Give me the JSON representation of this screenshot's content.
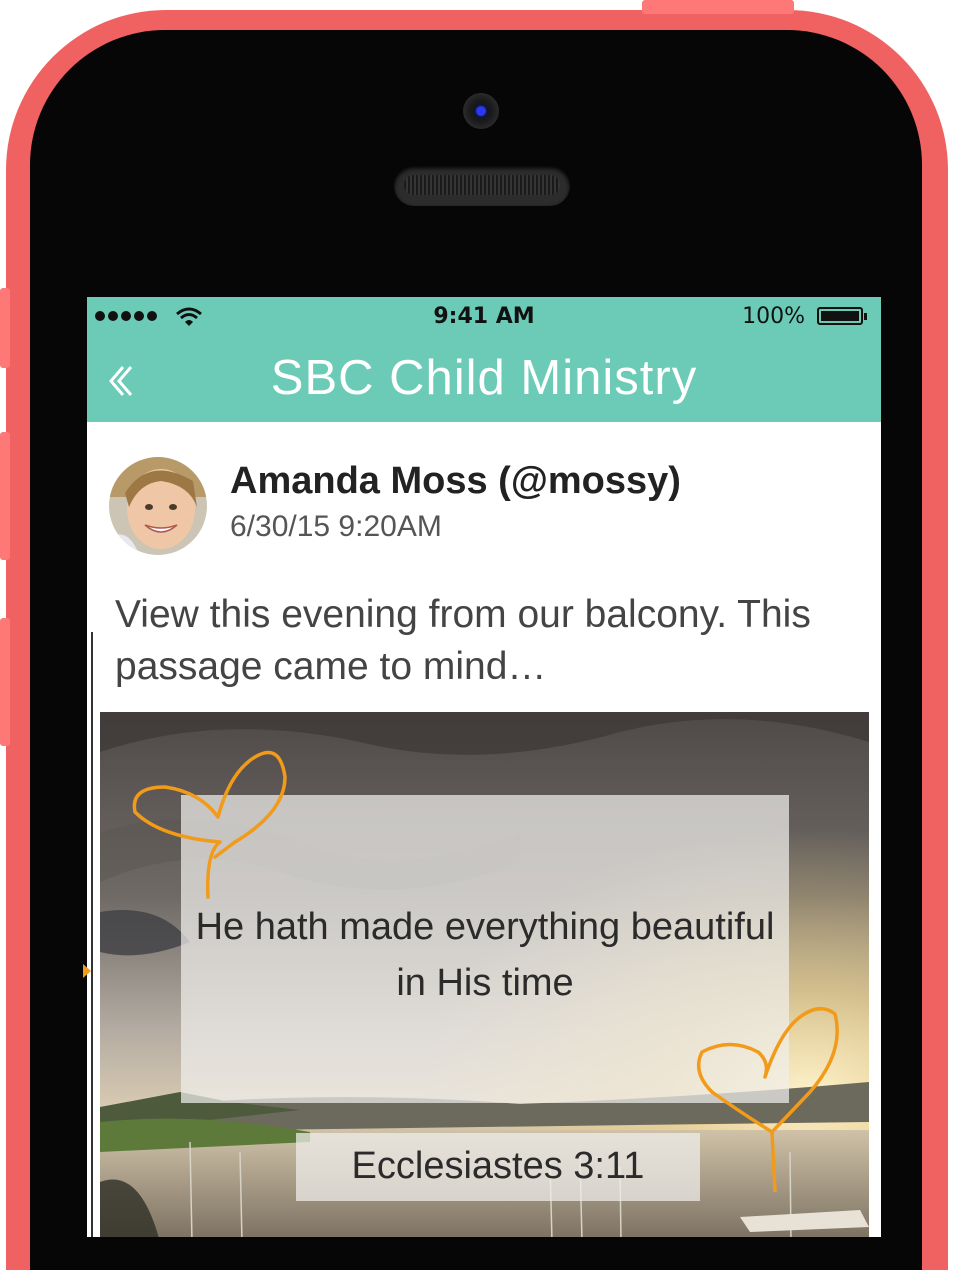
{
  "status_bar": {
    "time": "9:41 AM",
    "battery_percent": "100%"
  },
  "nav": {
    "title": "SBC Child Ministry",
    "back_icon": "chevron-left-icon"
  },
  "post": {
    "author": "Amanda Moss (@mossy)",
    "date": "6/30/15  9:20AM",
    "text": "View this evening from our balcony.  This passage came to mind…",
    "image": {
      "quote": "He hath made everything beautiful in His time",
      "reference": "Ecclesiastes 3:11",
      "doodles": [
        "heart-doodle",
        "heart-doodle"
      ]
    }
  },
  "colors": {
    "accent": "#6bcbb7",
    "phone_shell": "#f06262",
    "doodle": "#f29a1a"
  }
}
